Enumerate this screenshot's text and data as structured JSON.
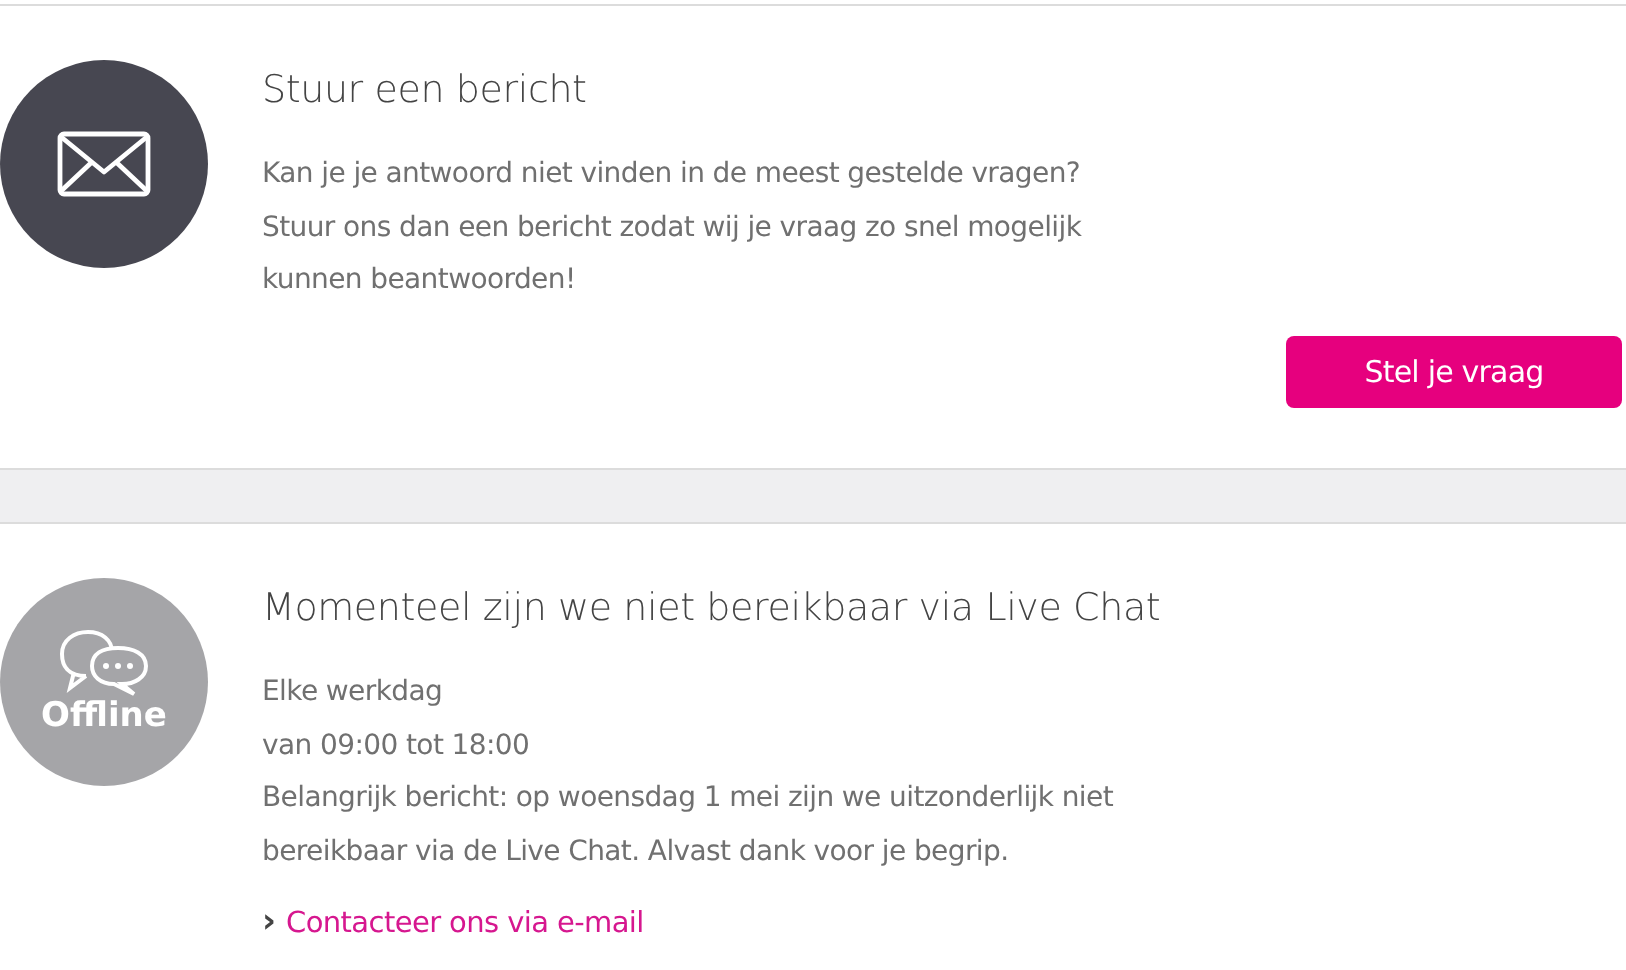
{
  "message_section": {
    "title": "Stuur een bericht",
    "lines": [
      "Kan je je antwoord niet vinden in de meest gestelde vragen?",
      "Stuur ons dan een bericht zodat wij je vraag zo snel mogelijk",
      "kunnen beantwoorden!"
    ],
    "button": "Stel je vraag"
  },
  "chat_section": {
    "badge": "Offline",
    "title": "Momenteel zijn we niet bereikbaar via Live Chat",
    "lines": [
      "Elke werkdag",
      "van 09:00 tot 18:00",
      "Belangrijk bericht: op woensdag 1 mei zijn we uitzonderlijk niet",
      "bereikbaar via de Live Chat. Alvast dank voor je begrip."
    ],
    "link_arrow": "›",
    "link": "Contacteer ons via e-mail"
  }
}
